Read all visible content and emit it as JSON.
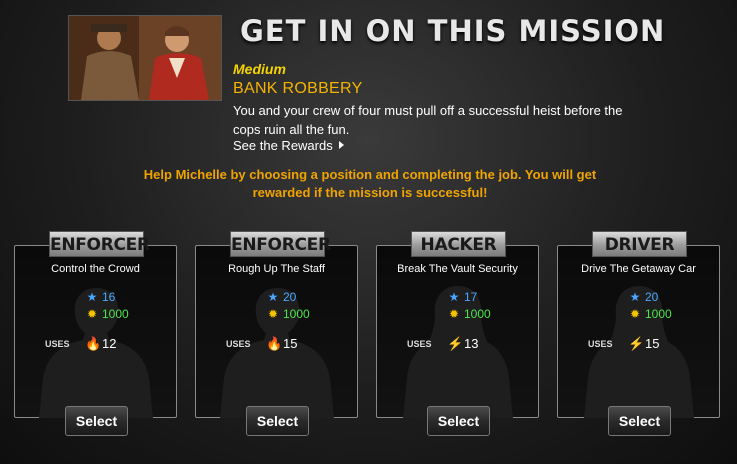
{
  "header": {
    "title": "GET IN ON THIS MISSION",
    "difficulty": "Medium",
    "mission_name": "BANK ROBBERY",
    "description": "You and your crew of four must pull off a successful heist before the cops ruin all the fun.",
    "rewards_link": "See the Rewards",
    "help_text": "Help Michelle by choosing a position and completing the job. You will get rewarded if the mission is successful!"
  },
  "colors": {
    "difficulty": "#f5d400",
    "mission_name": "#f5b400",
    "help_text": "#f0a400",
    "star_value": "#4aa7ff",
    "gold_value": "#4ee64e"
  },
  "positions": [
    {
      "role": "ENFORCER",
      "task": "Control the Crowd",
      "stars": "16",
      "gold": "1000",
      "uses_label": "USES",
      "uses": "12",
      "uses_icon": "fire-icon",
      "button": "Select"
    },
    {
      "role": "ENFORCER",
      "task": "Rough Up The Staff",
      "stars": "20",
      "gold": "1000",
      "uses_label": "USES",
      "uses": "15",
      "uses_icon": "fire-icon",
      "button": "Select"
    },
    {
      "role": "HACKER",
      "task": "Break The Vault Security",
      "stars": "17",
      "gold": "1000",
      "uses_label": "USES",
      "uses": "13",
      "uses_icon": "bolt-icon",
      "button": "Select"
    },
    {
      "role": "DRIVER",
      "task": "Drive The Getaway Car",
      "stars": "20",
      "gold": "1000",
      "uses_label": "USES",
      "uses": "15",
      "uses_icon": "bolt-icon",
      "button": "Select"
    }
  ]
}
